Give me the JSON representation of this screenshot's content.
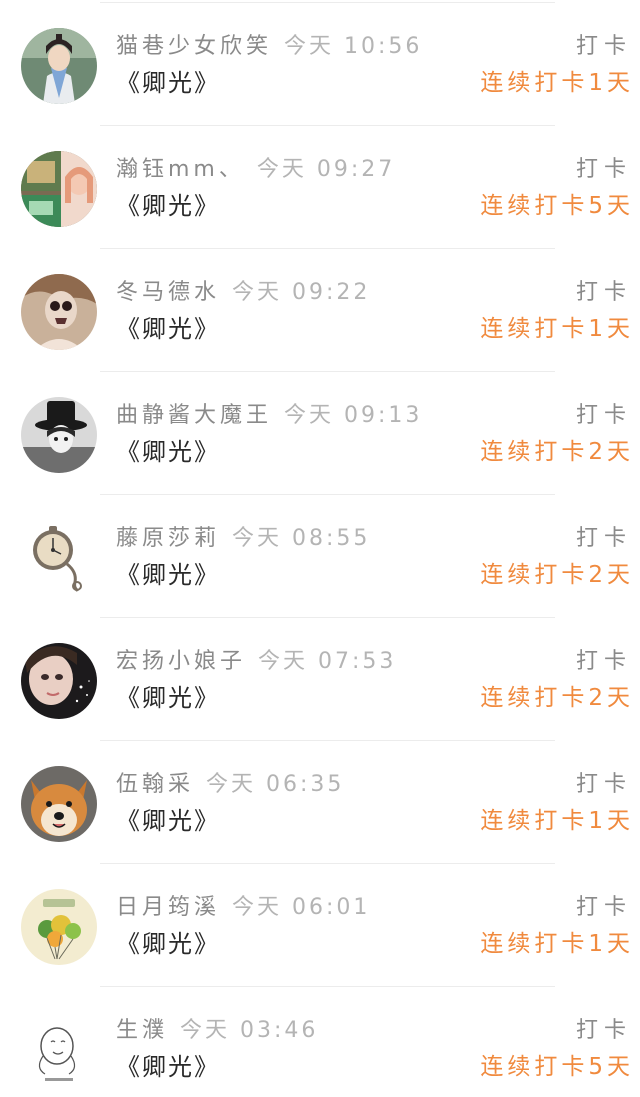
{
  "checkins": [
    {
      "name": "猫巷少女欣笑",
      "time": "今天 10:56",
      "book": "《卿光》",
      "action": "打卡",
      "streak": "连续打卡1天",
      "avatar": "avatar-costume-portrait"
    },
    {
      "name": "瀚钰mm、",
      "time": "今天 09:27",
      "book": "《卿光》",
      "action": "打卡",
      "streak": "连续打卡5天",
      "avatar": "avatar-collage"
    },
    {
      "name": "冬马德水",
      "time": "今天 09:22",
      "book": "《卿光》",
      "action": "打卡",
      "streak": "连续打卡1天",
      "avatar": "avatar-skull-makeup"
    },
    {
      "name": "曲静酱大魔王",
      "time": "今天 09:13",
      "book": "《卿光》",
      "action": "打卡",
      "streak": "连续打卡2天",
      "avatar": "avatar-top-hat"
    },
    {
      "name": "藤原莎莉",
      "time": "今天 08:55",
      "book": "《卿光》",
      "action": "打卡",
      "streak": "连续打卡2天",
      "avatar": "avatar-pocket-watch"
    },
    {
      "name": "宏扬小娘子",
      "time": "今天 07:53",
      "book": "《卿光》",
      "action": "打卡",
      "streak": "连续打卡2天",
      "avatar": "avatar-sparkle-portrait"
    },
    {
      "name": "伍翰采",
      "time": "今天 06:35",
      "book": "《卿光》",
      "action": "打卡",
      "streak": "连续打卡1天",
      "avatar": "avatar-dog"
    },
    {
      "name": "日月筠溪",
      "time": "今天 06:01",
      "book": "《卿光》",
      "action": "打卡",
      "streak": "连续打卡1天",
      "avatar": "avatar-balloons"
    },
    {
      "name": "生濮",
      "time": "今天 03:46",
      "book": "《卿光》",
      "action": "打卡",
      "streak": "连续打卡5天",
      "avatar": "avatar-sketch"
    }
  ]
}
